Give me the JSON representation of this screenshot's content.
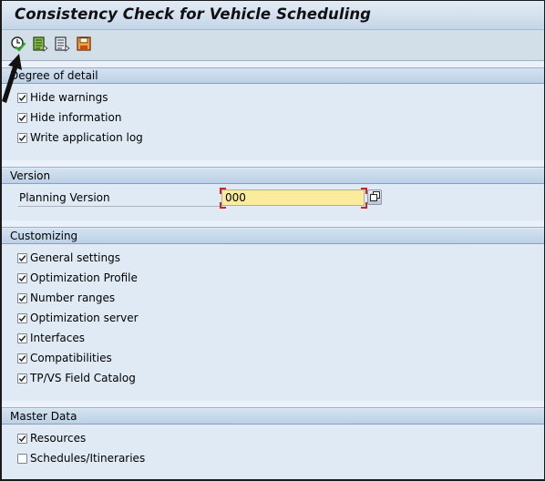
{
  "window": {
    "title": "Consistency Check for Vehicle Scheduling"
  },
  "toolbar": {
    "buttons": [
      {
        "icon": "execute-clock-check-icon",
        "tooltip": "Execute"
      },
      {
        "icon": "variant-get-icon",
        "tooltip": "Get Variant"
      },
      {
        "icon": "program-details-icon",
        "tooltip": "Details"
      },
      {
        "icon": "save-icon",
        "tooltip": "Save"
      }
    ]
  },
  "sections": {
    "degree_of_detail": {
      "header": "Degree of detail",
      "items": [
        {
          "label": "Hide warnings",
          "checked": true
        },
        {
          "label": "Hide information",
          "checked": true
        },
        {
          "label": "Write application log",
          "checked": true
        }
      ]
    },
    "version": {
      "header": "Version",
      "planning_version_label": "Planning Version",
      "planning_version_value": "000"
    },
    "customizing": {
      "header": "Customizing",
      "items": [
        {
          "label": "General settings",
          "checked": true
        },
        {
          "label": "Optimization Profile",
          "checked": true
        },
        {
          "label": "Number ranges",
          "checked": true
        },
        {
          "label": "Optimization server",
          "checked": true
        },
        {
          "label": "Interfaces",
          "checked": true
        },
        {
          "label": "Compatibilities",
          "checked": true
        },
        {
          "label": "TP/VS Field Catalog",
          "checked": true
        }
      ]
    },
    "master_data": {
      "header": "Master Data",
      "items": [
        {
          "label": "Resources",
          "checked": true
        },
        {
          "label": "Schedules/Itineraries",
          "checked": false
        }
      ]
    }
  },
  "colors": {
    "input_required_bg": "#fbeb9d",
    "required_marker": "#c8242b",
    "section_header": "#c7d9ea",
    "background": "#dfeaf4"
  }
}
